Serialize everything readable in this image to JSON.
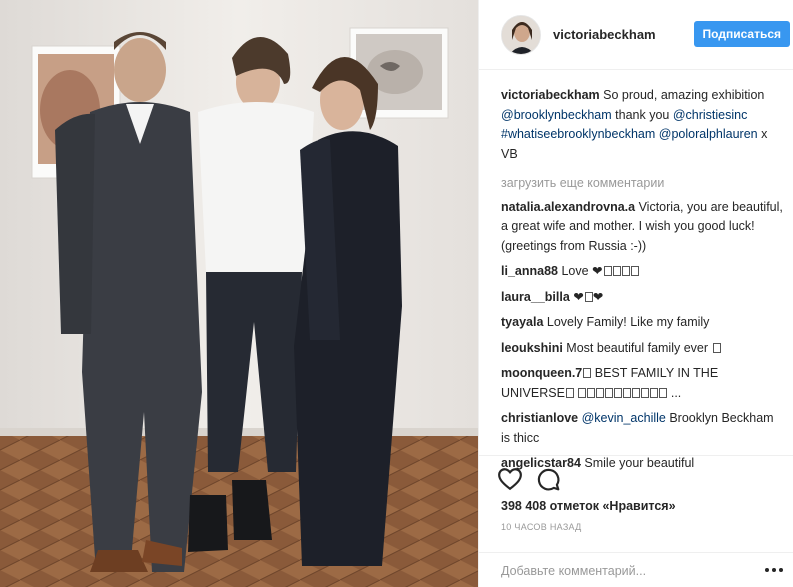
{
  "header": {
    "username": "victoriabeckham",
    "follow_label": "Подписаться"
  },
  "caption": {
    "user": "victoriabeckham",
    "text_1": " So proud, amazing exhibition ",
    "mention_1": "@brooklynbeckham",
    "text_2": " thank you ",
    "mention_2": "@christiesinc",
    "text_3": " ",
    "hashtag": "#whatiseebrooklynbeckham",
    "text_4": " ",
    "mention_3": "@poloralphlauren",
    "text_5": " x VB"
  },
  "load_more_label": "загрузить еще комментарии",
  "comments": [
    {
      "user": "natalia.alexandrovna.a",
      "text": " Victoria, you are beautiful, a great wife and mother. I wish you good luck! (greetings from Russia :-))"
    },
    {
      "user": "li_anna88",
      "text": " Love ❤"
    },
    {
      "user": "laura__billa",
      "text": " ❤"
    },
    {
      "user": "tyayala",
      "text": " Lovely Family! Like my family"
    },
    {
      "user": "leoukshini",
      "text": " Most beautiful family ever "
    },
    {
      "user": "moonqueen.7",
      "text": " BEST FAMILY IN THE UNIVERSE"
    },
    {
      "user": "christianlove",
      "mention": "@kevin_achille",
      "text": " Brooklyn Beckham is thicc"
    },
    {
      "user": "angelicstar84",
      "text": " Smile your beautiful"
    }
  ],
  "likes_label": "398 408 отметок «Нравится»",
  "timestamp": "10 ЧАСОВ НАЗАД",
  "comment_input": {
    "placeholder": "Добавьте комментарий..."
  },
  "icons": {
    "like": "heart-icon",
    "comment": "comment-bubble-icon",
    "more": "more-options-icon"
  },
  "colors": {
    "accent": "#3897f0",
    "link": "#003569",
    "muted": "#999999"
  }
}
